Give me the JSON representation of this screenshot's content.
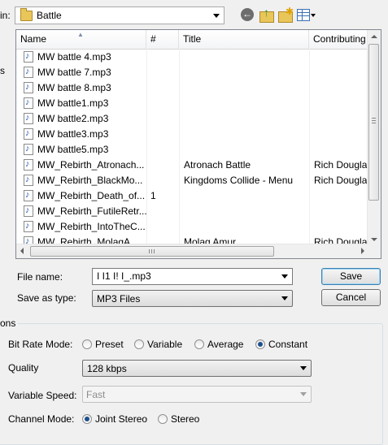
{
  "toolbar": {
    "save_in_label": "in:",
    "folder": "Battle"
  },
  "left_cut_text": "s",
  "list": {
    "columns": [
      "Name",
      "#",
      "Title",
      "Contributing"
    ],
    "rows": [
      {
        "name": "MW battle 4.mp3",
        "num": "",
        "title": "",
        "contrib": ""
      },
      {
        "name": "MW battle 7.mp3",
        "num": "",
        "title": "",
        "contrib": ""
      },
      {
        "name": "MW battle 8.mp3",
        "num": "",
        "title": "",
        "contrib": ""
      },
      {
        "name": "MW battle1.mp3",
        "num": "",
        "title": "",
        "contrib": ""
      },
      {
        "name": "MW battle2.mp3",
        "num": "",
        "title": "",
        "contrib": ""
      },
      {
        "name": "MW battle3.mp3",
        "num": "",
        "title": "",
        "contrib": ""
      },
      {
        "name": "MW battle5.mp3",
        "num": "",
        "title": "",
        "contrib": ""
      },
      {
        "name": "MW_Rebirth_Atronach...",
        "num": "",
        "title": "Atronach Battle",
        "contrib": "Rich Douglas"
      },
      {
        "name": "MW_Rebirth_BlackMo...",
        "num": "",
        "title": "Kingdoms Collide - Menu",
        "contrib": "Rich Douglas"
      },
      {
        "name": "MW_Rebirth_Death_of...",
        "num": "1",
        "title": "",
        "contrib": ""
      },
      {
        "name": "MW_Rebirth_FutileRetr...",
        "num": "",
        "title": "",
        "contrib": ""
      },
      {
        "name": "MW_Rebirth_IntoTheC...",
        "num": "",
        "title": "",
        "contrib": ""
      },
      {
        "name": "MW_Rebirth_MolagA...",
        "num": "",
        "title": "Molag Amur",
        "contrib": "Rich Douglas"
      }
    ]
  },
  "form": {
    "filename_label": "File name:",
    "filename_value": "I  I1 I!  I_.mp3",
    "savetype_label": "Save as type:",
    "savetype_value": "MP3 Files",
    "save_button": "Save",
    "cancel_button": "Cancel"
  },
  "options": {
    "legend": "ons",
    "bitrate_label": "Bit Rate Mode:",
    "bitrate_options": [
      "Preset",
      "Variable",
      "Average",
      "Constant"
    ],
    "bitrate_selected": "Constant",
    "quality_label": "Quality",
    "quality_value": "128 kbps",
    "varspeed_label": "Variable Speed:",
    "varspeed_value": "Fast",
    "channel_label": "Channel Mode:",
    "channel_options": [
      "Joint Stereo",
      "Stereo"
    ],
    "channel_selected": "Joint Stereo"
  }
}
